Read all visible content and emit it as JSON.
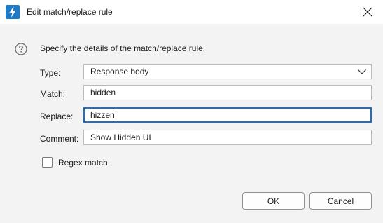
{
  "window": {
    "title": "Edit match/replace rule",
    "app_icon": "lightning-bolt-icon",
    "close_icon": "close-icon"
  },
  "instruction": "Specify the details of the match/replace rule.",
  "help_icon": "question-circle-icon",
  "fields": {
    "type": {
      "label": "Type:",
      "value": "Response body"
    },
    "match": {
      "label": "Match:",
      "value": "hidden"
    },
    "replace": {
      "label": "Replace:",
      "value": "hizzen"
    },
    "comment": {
      "label": "Comment:",
      "value": "Show Hidden UI"
    }
  },
  "regex": {
    "label": "Regex match",
    "checked": false
  },
  "buttons": {
    "ok": "OK",
    "cancel": "Cancel"
  },
  "colors": {
    "accent": "#1e7ac4",
    "focus_border": "#1e6fc9",
    "background": "#f3f3f3"
  }
}
